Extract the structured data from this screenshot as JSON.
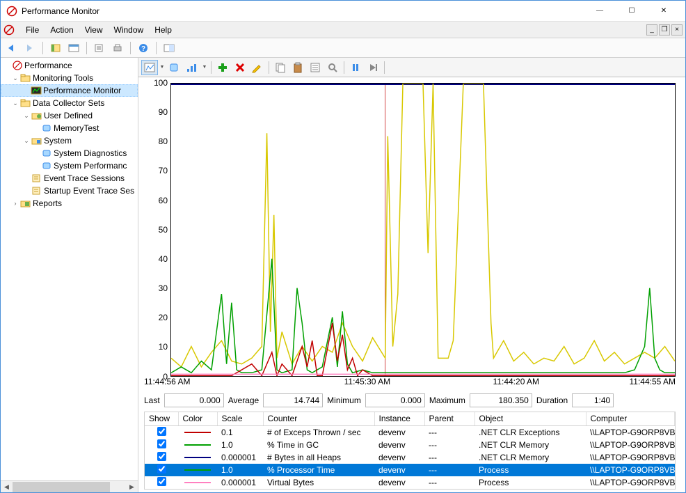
{
  "window": {
    "title": "Performance Monitor",
    "minimize": "—",
    "maximize": "☐",
    "close": "✕"
  },
  "menu": {
    "file": "File",
    "action": "Action",
    "view": "View",
    "window": "Window",
    "help": "Help"
  },
  "tree": {
    "root": "Performance",
    "monitoring_tools": "Monitoring Tools",
    "performance_monitor": "Performance Monitor",
    "data_collector_sets": "Data Collector Sets",
    "user_defined": "User Defined",
    "memory_test": "MemoryTest",
    "system": "System",
    "system_diagnostics": "System Diagnostics",
    "system_performance": "System Performanc",
    "event_trace": "Event Trace Sessions",
    "startup_event_trace": "Startup Event Trace Ses",
    "reports": "Reports"
  },
  "stats": {
    "last_label": "Last",
    "last_value": "0.000",
    "average_label": "Average",
    "average_value": "14.744",
    "minimum_label": "Minimum",
    "minimum_value": "0.000",
    "maximum_label": "Maximum",
    "maximum_value": "180.350",
    "duration_label": "Duration",
    "duration_value": "1:40"
  },
  "counter_table": {
    "headers": {
      "show": "Show",
      "color": "Color",
      "scale": "Scale",
      "counter": "Counter",
      "instance": "Instance",
      "parent": "Parent",
      "object": "Object",
      "computer": "Computer"
    },
    "rows": [
      {
        "show": true,
        "color": "#c00000",
        "scale": "0.1",
        "counter": "# of Exceps Thrown / sec",
        "instance": "devenv",
        "parent": "---",
        "object": ".NET CLR Exceptions",
        "computer": "\\\\LAPTOP-G9ORP8VB"
      },
      {
        "show": true,
        "color": "#00a000",
        "scale": "1.0",
        "counter": "% Time in GC",
        "instance": "devenv",
        "parent": "---",
        "object": ".NET CLR Memory",
        "computer": "\\\\LAPTOP-G9ORP8VB"
      },
      {
        "show": true,
        "color": "#000080",
        "scale": "0.000001",
        "counter": "# Bytes in all Heaps",
        "instance": "devenv",
        "parent": "---",
        "object": ".NET CLR Memory",
        "computer": "\\\\LAPTOP-G9ORP8VB"
      },
      {
        "show": true,
        "color": "#00a000",
        "scale": "1.0",
        "counter": "% Processor Time",
        "instance": "devenv",
        "parent": "---",
        "object": "Process",
        "computer": "\\\\LAPTOP-G9ORP8VB",
        "selected": true
      },
      {
        "show": true,
        "color": "#ff80c0",
        "scale": "0.000001",
        "counter": "Virtual Bytes",
        "instance": "devenv",
        "parent": "---",
        "object": "Process",
        "computer": "\\\\LAPTOP-G9ORP8VB"
      }
    ]
  },
  "chart_data": {
    "type": "line",
    "ylim": [
      0,
      100
    ],
    "y_ticks": [
      0,
      10,
      20,
      30,
      40,
      50,
      60,
      70,
      80,
      90,
      100
    ],
    "x_tick_labels": [
      "11:44:56 AM",
      "11:45:30 AM",
      "11:44:20 AM",
      "11:44:55 AM"
    ],
    "x_tick_positions": [
      0,
      42,
      70,
      100
    ],
    "time_divider_x_pct": 42.5,
    "series": [
      {
        "name": "# Bytes in all Heaps",
        "object": ".NET CLR Memory",
        "color": "#000080",
        "scale": 1e-06,
        "values_pct": [
          [
            0,
            100
          ],
          [
            100,
            100
          ]
        ]
      },
      {
        "name": "% Processor Time",
        "object": "Process",
        "color": "#d8c800",
        "scale": 1.0,
        "values_pct": [
          [
            0,
            6
          ],
          [
            2,
            3
          ],
          [
            4,
            10
          ],
          [
            6,
            3
          ],
          [
            8,
            8
          ],
          [
            10,
            12
          ],
          [
            12,
            5
          ],
          [
            14,
            4
          ],
          [
            16,
            6
          ],
          [
            18,
            10
          ],
          [
            19,
            83
          ],
          [
            19.7,
            15
          ],
          [
            20.4,
            55
          ],
          [
            21,
            6
          ],
          [
            22,
            15
          ],
          [
            24,
            4
          ],
          [
            26,
            10
          ],
          [
            28,
            5
          ],
          [
            30,
            10
          ],
          [
            32,
            8
          ],
          [
            34,
            18
          ],
          [
            36,
            10
          ],
          [
            38,
            5
          ],
          [
            40,
            13
          ],
          [
            42.5,
            6
          ],
          [
            43,
            82
          ],
          [
            44,
            10
          ],
          [
            45,
            28
          ],
          [
            46,
            100
          ],
          [
            48,
            100
          ],
          [
            50,
            100
          ],
          [
            51,
            42
          ],
          [
            52,
            100
          ],
          [
            53,
            6
          ],
          [
            55,
            6
          ],
          [
            56,
            12
          ],
          [
            58,
            100
          ],
          [
            60,
            100
          ],
          [
            62,
            100
          ],
          [
            63.5,
            18
          ],
          [
            64,
            6
          ],
          [
            66,
            12
          ],
          [
            68,
            5
          ],
          [
            70,
            8
          ],
          [
            72,
            4
          ],
          [
            74,
            6
          ],
          [
            76,
            5
          ],
          [
            78,
            10
          ],
          [
            80,
            4
          ],
          [
            82,
            6
          ],
          [
            84,
            12
          ],
          [
            86,
            5
          ],
          [
            88,
            8
          ],
          [
            90,
            4
          ],
          [
            92,
            6
          ],
          [
            94,
            8
          ],
          [
            96,
            6
          ],
          [
            98,
            10
          ],
          [
            100,
            5
          ]
        ]
      },
      {
        "name": "% Time in GC",
        "object": ".NET CLR Memory",
        "color": "#00a000",
        "scale": 1.0,
        "values_pct": [
          [
            0,
            1
          ],
          [
            2,
            3
          ],
          [
            4,
            1
          ],
          [
            6,
            5
          ],
          [
            8,
            2
          ],
          [
            10,
            28
          ],
          [
            11,
            4
          ],
          [
            12,
            25
          ],
          [
            13,
            2
          ],
          [
            14,
            1
          ],
          [
            16,
            1
          ],
          [
            18,
            2
          ],
          [
            20,
            40
          ],
          [
            21,
            2
          ],
          [
            22,
            1
          ],
          [
            24,
            2
          ],
          [
            25,
            30
          ],
          [
            26,
            18
          ],
          [
            27,
            2
          ],
          [
            28,
            1
          ],
          [
            30,
            3
          ],
          [
            32,
            20
          ],
          [
            33,
            3
          ],
          [
            34,
            22
          ],
          [
            35,
            4
          ],
          [
            36,
            1
          ],
          [
            38,
            2
          ],
          [
            40,
            1
          ],
          [
            42.5,
            1
          ],
          [
            43,
            1
          ],
          [
            46,
            1
          ],
          [
            50,
            1
          ],
          [
            54,
            1
          ],
          [
            58,
            1
          ],
          [
            62,
            1
          ],
          [
            66,
            1
          ],
          [
            70,
            1
          ],
          [
            74,
            1
          ],
          [
            78,
            1
          ],
          [
            82,
            1
          ],
          [
            86,
            1
          ],
          [
            90,
            1
          ],
          [
            92,
            2
          ],
          [
            94,
            10
          ],
          [
            95,
            30
          ],
          [
            96,
            6
          ],
          [
            97,
            2
          ],
          [
            98,
            1
          ],
          [
            100,
            1
          ]
        ]
      },
      {
        "name": "# of Exceps Thrown / sec",
        "object": ".NET CLR Exceptions",
        "color": "#c00000",
        "scale": 0.1,
        "values_pct": [
          [
            0,
            0
          ],
          [
            4,
            0
          ],
          [
            8,
            0
          ],
          [
            12,
            0
          ],
          [
            16,
            4
          ],
          [
            18,
            0
          ],
          [
            20,
            8
          ],
          [
            21,
            0
          ],
          [
            22,
            4
          ],
          [
            24,
            0
          ],
          [
            26,
            10
          ],
          [
            27,
            3
          ],
          [
            28,
            12
          ],
          [
            29,
            0
          ],
          [
            30,
            0
          ],
          [
            32,
            18
          ],
          [
            33,
            5
          ],
          [
            34,
            14
          ],
          [
            35,
            2
          ],
          [
            36,
            6
          ],
          [
            37,
            0
          ],
          [
            38,
            2
          ],
          [
            40,
            0
          ],
          [
            42.5,
            0
          ],
          [
            46,
            0
          ],
          [
            50,
            0
          ],
          [
            60,
            0
          ],
          [
            70,
            0
          ],
          [
            80,
            0
          ],
          [
            90,
            0
          ],
          [
            100,
            0
          ]
        ]
      },
      {
        "name": "Virtual Bytes",
        "object": "Process",
        "color": "#ff80c0",
        "scale": 1e-06,
        "values_pct": [
          [
            0,
            0.5
          ],
          [
            100,
            0.5
          ]
        ]
      }
    ]
  }
}
